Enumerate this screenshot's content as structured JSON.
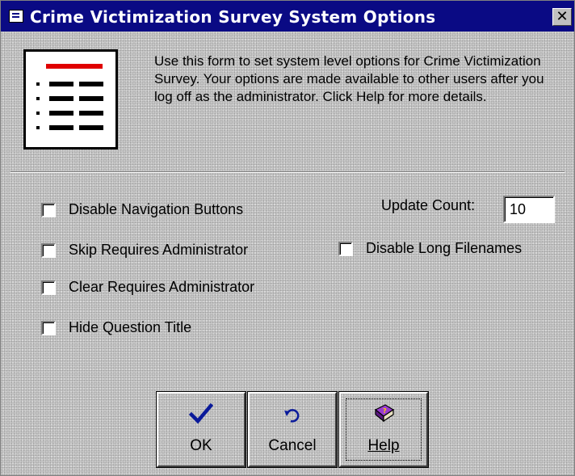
{
  "window": {
    "title": "Crime Victimization Survey System Options",
    "close_glyph": "✕"
  },
  "intro": {
    "text": "Use this form to set system level options for Crime Victimization Survey. Your options are made available to other users after you log off as the administrator. Click Help for more details."
  },
  "options": {
    "disable_navigation_buttons": {
      "label": "Disable Navigation Buttons",
      "checked": false
    },
    "skip_requires_administrator": {
      "label": "Skip Requires Administrator",
      "checked": false
    },
    "clear_requires_administrator": {
      "label": "Clear Requires Administrator",
      "checked": false
    },
    "hide_question_title": {
      "label": "Hide Question Title",
      "checked": false
    },
    "disable_long_filenames": {
      "label": "Disable Long Filenames",
      "checked": false
    }
  },
  "update_count": {
    "label": "Update Count:",
    "value": "10"
  },
  "buttons": {
    "ok": {
      "label": "OK",
      "icon": "checkmark-icon"
    },
    "cancel": {
      "label": "Cancel",
      "icon": "undo-icon"
    },
    "help": {
      "label": "Help",
      "icon": "help-book-icon"
    }
  },
  "colors": {
    "titlebar": "#0a0a84",
    "checkmark": "#0a1a9a",
    "help_book": "#7a2aa0",
    "doc_red_bar": "#e00000"
  }
}
